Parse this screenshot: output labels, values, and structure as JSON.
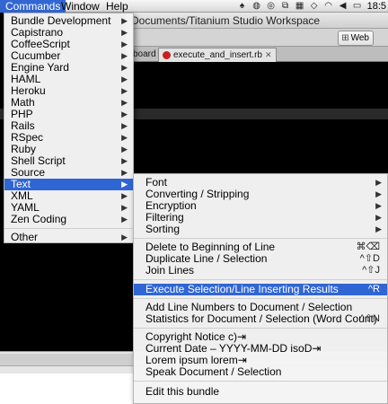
{
  "menubar": {
    "items": [
      {
        "label": "Commands"
      },
      {
        "label": "Window"
      },
      {
        "label": "Help"
      }
    ],
    "clock": "18:5"
  },
  "window": {
    "title": "Documents/Titanium Studio Workspace",
    "web_button": "Web",
    "tabs": [
      {
        "label": "board"
      },
      {
        "label": "execute_and_insert.rb"
      }
    ]
  },
  "commands_menu": {
    "items": [
      {
        "label": "Bundle Development",
        "submenu": true
      },
      {
        "label": "Capistrano",
        "submenu": true
      },
      {
        "label": "CoffeeScript",
        "submenu": true
      },
      {
        "label": "Cucumber",
        "submenu": true
      },
      {
        "label": "Engine Yard",
        "submenu": true
      },
      {
        "label": "HAML",
        "submenu": true
      },
      {
        "label": "Heroku",
        "submenu": true
      },
      {
        "label": "Math",
        "submenu": true
      },
      {
        "label": "PHP",
        "submenu": true
      },
      {
        "label": "Rails",
        "submenu": true
      },
      {
        "label": "RSpec",
        "submenu": true
      },
      {
        "label": "Ruby",
        "submenu": true
      },
      {
        "label": "Shell Script",
        "submenu": true
      },
      {
        "label": "Source",
        "submenu": true
      },
      {
        "label": "Text",
        "submenu": true,
        "selected": true
      },
      {
        "label": "XML",
        "submenu": true
      },
      {
        "label": "YAML",
        "submenu": true
      },
      {
        "label": "Zen Coding",
        "submenu": true
      },
      {
        "label": "Other",
        "submenu": true
      }
    ]
  },
  "text_menu": {
    "items": [
      {
        "label": "Font",
        "submenu": true
      },
      {
        "label": "Converting / Stripping",
        "submenu": true
      },
      {
        "label": "Encryption",
        "submenu": true
      },
      {
        "label": "Filtering",
        "submenu": true
      },
      {
        "label": "Sorting",
        "submenu": true
      },
      {
        "label": "Delete to Beginning of Line",
        "shortcut": "⌘⌫"
      },
      {
        "label": "Duplicate Line / Selection",
        "shortcut": "^⇧D"
      },
      {
        "label": "Join Lines",
        "shortcut": "^⇧J"
      },
      {
        "label": "Execute Selection/Line Inserting Results",
        "shortcut": "^R",
        "selected": true
      },
      {
        "label": "Add Line Numbers to Document / Selection"
      },
      {
        "label": "Statistics for Document / Selection (Word Count)",
        "shortcut": "^⇧N"
      },
      {
        "label": "Copyright Notice c)⇥"
      },
      {
        "label": "Current Date – YYYY-MM-DD isoD⇥"
      },
      {
        "label": "Lorem ipsum lorem⇥"
      },
      {
        "label": "Speak Document / Selection"
      },
      {
        "label": "Edit this bundle"
      }
    ]
  },
  "colors": {
    "selection": "#3066d4",
    "editor_bg": "#000000",
    "ruby_icon": "#c9201f"
  }
}
